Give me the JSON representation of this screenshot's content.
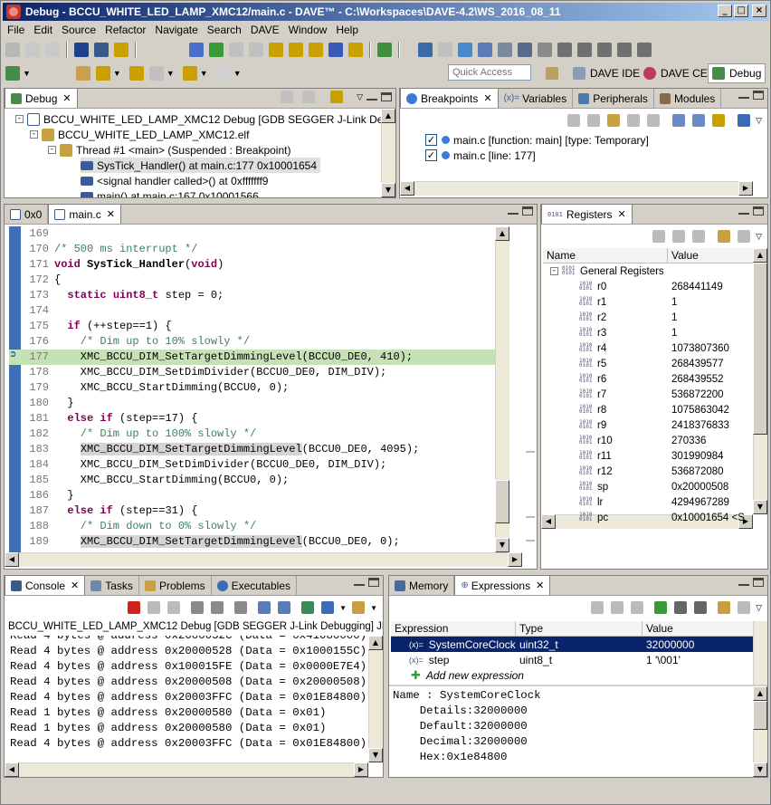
{
  "window": {
    "title": "Debug - BCCU_WHITE_LED_LAMP_XMC12/main.c - DAVE™ - C:\\Workspaces\\DAVE-4.2\\WS_2016_08_11"
  },
  "menu": [
    "File",
    "Edit",
    "Source",
    "Refactor",
    "Navigate",
    "Search",
    "DAVE",
    "Window",
    "Help"
  ],
  "quick_access": {
    "placeholder": "Quick Access"
  },
  "perspectives": [
    "DAVE IDE",
    "DAVE CE",
    "Debug"
  ],
  "debug_view": {
    "tab": "Debug",
    "tree": [
      "BCCU_WHITE_LED_LAMP_XMC12 Debug [GDB SEGGER J-Link Debugging]",
      "BCCU_WHITE_LED_LAMP_XMC12.elf",
      "Thread #1 <main> (Suspended : Breakpoint)",
      "SysTick_Handler() at main.c:177 0x10001654",
      "<signal handler called>() at 0xfffffff9",
      "main() at main.c:167 0x10001566"
    ]
  },
  "top_right_tabs": [
    "Breakpoints",
    "Variables",
    "Peripherals",
    "Modules"
  ],
  "breakpoints": [
    "main.c [function: main] [type: Temporary]",
    "main.c [line: 177]"
  ],
  "editor": {
    "tabs": [
      "0x0",
      "main.c"
    ],
    "lines": [
      {
        "n": "169",
        "code": ""
      },
      {
        "n": "170",
        "code": "/* 500 ms interrupt */"
      },
      {
        "n": "171",
        "code": "void SysTick_Handler(void)"
      },
      {
        "n": "172",
        "code": "{"
      },
      {
        "n": "173",
        "code": "  static uint8_t step = 0;"
      },
      {
        "n": "174",
        "code": ""
      },
      {
        "n": "175",
        "code": "  if (++step==1) {"
      },
      {
        "n": "176",
        "code": "    /* Dim up to 10% slowly */"
      },
      {
        "n": "177",
        "code": "    XMC_BCCU_DIM_SetTargetDimmingLevel(BCCU0_DE0, 410);"
      },
      {
        "n": "178",
        "code": "    XMC_BCCU_DIM_SetDimDivider(BCCU0_DE0, DIM_DIV);"
      },
      {
        "n": "179",
        "code": "    XMC_BCCU_StartDimming(BCCU0, 0);"
      },
      {
        "n": "180",
        "code": "  }"
      },
      {
        "n": "181",
        "code": "  else if (step==17) {"
      },
      {
        "n": "182",
        "code": "    /* Dim up to 100% slowly */"
      },
      {
        "n": "183",
        "code": "    XMC_BCCU_DIM_SetTargetDimmingLevel(BCCU0_DE0, 4095);"
      },
      {
        "n": "184",
        "code": "    XMC_BCCU_DIM_SetDimDivider(BCCU0_DE0, DIM_DIV);"
      },
      {
        "n": "185",
        "code": "    XMC_BCCU_StartDimming(BCCU0, 0);"
      },
      {
        "n": "186",
        "code": "  }"
      },
      {
        "n": "187",
        "code": "  else if (step==31) {"
      },
      {
        "n": "188",
        "code": "    /* Dim down to 0% slowly */"
      },
      {
        "n": "189",
        "code": "    XMC_BCCU_DIM_SetTargetDimmingLevel(BCCU0_DE0, 0);"
      }
    ]
  },
  "registers": {
    "tab": "Registers",
    "columns": [
      "Name",
      "Value"
    ],
    "group": "General Registers",
    "rows": [
      {
        "name": "r0",
        "value": "268441149"
      },
      {
        "name": "r1",
        "value": "1"
      },
      {
        "name": "r2",
        "value": "1"
      },
      {
        "name": "r3",
        "value": "1"
      },
      {
        "name": "r4",
        "value": "1073807360"
      },
      {
        "name": "r5",
        "value": "268439577"
      },
      {
        "name": "r6",
        "value": "268439552"
      },
      {
        "name": "r7",
        "value": "536872200"
      },
      {
        "name": "r8",
        "value": "1075863042"
      },
      {
        "name": "r9",
        "value": "2418376833"
      },
      {
        "name": "r10",
        "value": "270336"
      },
      {
        "name": "r11",
        "value": "301990984"
      },
      {
        "name": "r12",
        "value": "536872080"
      },
      {
        "name": "sp",
        "value": "0x20000508"
      },
      {
        "name": "lr",
        "value": "4294967289"
      },
      {
        "name": "pc",
        "value": "0x10001654 <S"
      }
    ]
  },
  "console": {
    "tabs": [
      "Console",
      "Tasks",
      "Problems",
      "Executables"
    ],
    "title": "BCCU_WHITE_LED_LAMP_XMC12 Debug [GDB SEGGER J-Link Debugging] JLinkGDBServerCL",
    "lines": [
      "Read 4 bytes @ address 0x2000052C (Data = 0x41080000)",
      "Read 4 bytes @ address 0x20000528 (Data = 0x1000155C)",
      "Read 4 bytes @ address 0x100015FE (Data = 0x0000E7E4)",
      "Read 4 bytes @ address 0x20000508 (Data = 0x20000508)",
      "Read 4 bytes @ address 0x20003FFC (Data = 0x01E84800)",
      "Read 1 bytes @ address 0x20000580 (Data = 0x01)",
      "Read 1 bytes @ address 0x20000580 (Data = 0x01)",
      "Read 4 bytes @ address 0x20003FFC (Data = 0x01E84800)"
    ]
  },
  "expressions": {
    "tabs": [
      "Memory",
      "Expressions"
    ],
    "columns": [
      "Expression",
      "Type",
      "Value"
    ],
    "rows": [
      {
        "expr": "SystemCoreClock",
        "type": "uint32_t",
        "value": "32000000"
      },
      {
        "expr": "step",
        "type": "uint8_t",
        "value": "1 '\\001'"
      }
    ],
    "add_new": "Add new expression",
    "details": [
      "Name : SystemCoreClock",
      "    Details:32000000",
      "    Default:32000000",
      "    Decimal:32000000",
      "    Hex:0x1e84800"
    ]
  },
  "colors": {
    "accent": "#0a246a",
    "current_line": "#c5e2b6",
    "keyword": "#7f0055",
    "comment": "#3f7f5f"
  }
}
